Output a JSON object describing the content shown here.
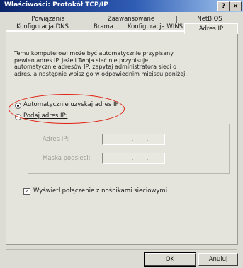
{
  "window": {
    "title": "Właściwości: Protokół TCP/IP",
    "help_btn": "?",
    "close_btn": "×"
  },
  "tabs": {
    "row1": [
      "Powiązania",
      "Zaawansowane",
      "NetBIOS"
    ],
    "row2": [
      "Konfiguracja DNS",
      "Brama",
      "Konfiguracja WINS",
      "Adres IP"
    ],
    "active": "Adres IP"
  },
  "description": "Temu komputerowi może być automatycznie przypisany pewien adres IP. Jeżeli Twoja sieć nie przypisuje automatycznie adresów IP, zapytaj administratora sieci o adres, a następnie wpisz go w odpowiednim miejscu poniżej.",
  "options": {
    "auto": "Automatycznie uzyskaj adres IP",
    "manual": "Podaj adres IP:",
    "selected": "auto"
  },
  "fields": {
    "ip_label": "Adres IP:",
    "mask_label": "Maska podsieci:",
    "ip_value": "",
    "mask_value": ""
  },
  "checkbox": {
    "label": "Wyświetl połączenie z nośnikami sieciowymi",
    "checked": true,
    "mark": "✓"
  },
  "buttons": {
    "ok": "OK",
    "cancel": "Anuluj"
  },
  "colors": {
    "highlight_ellipse": "#e02010",
    "title_bar": "#0a246a"
  }
}
